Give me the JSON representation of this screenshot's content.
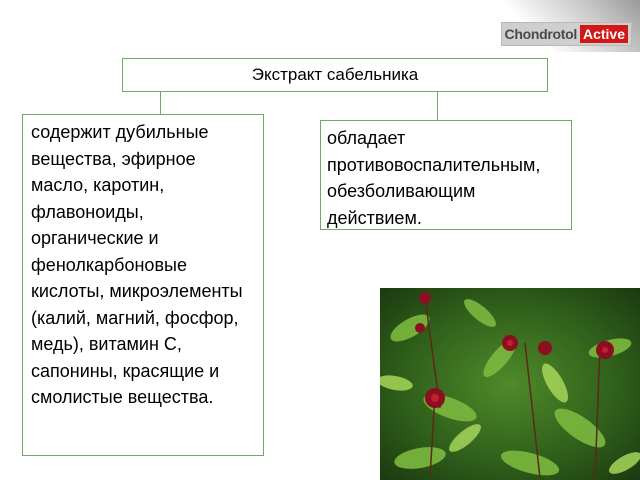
{
  "logo": {
    "part1": "Chondrotol",
    "part2": "Active"
  },
  "diagram": {
    "title": "Экстракт сабельника",
    "left_text": "содержит дубильные вещества, эфирное масло, каротин, флавоноиды, органические и фенолкарбоновые кислоты, микроэлементы (калий, магний, фосфор, медь), витамин С, сапонины, красящие и смолистые вещества.",
    "right_text": "обладает противовоспалительным, обезболивающим действием."
  },
  "colors": {
    "border": "#6bab5f",
    "brand_red": "#d01818"
  },
  "image": {
    "subject": "marsh-cinquefoil-plant-photo"
  }
}
